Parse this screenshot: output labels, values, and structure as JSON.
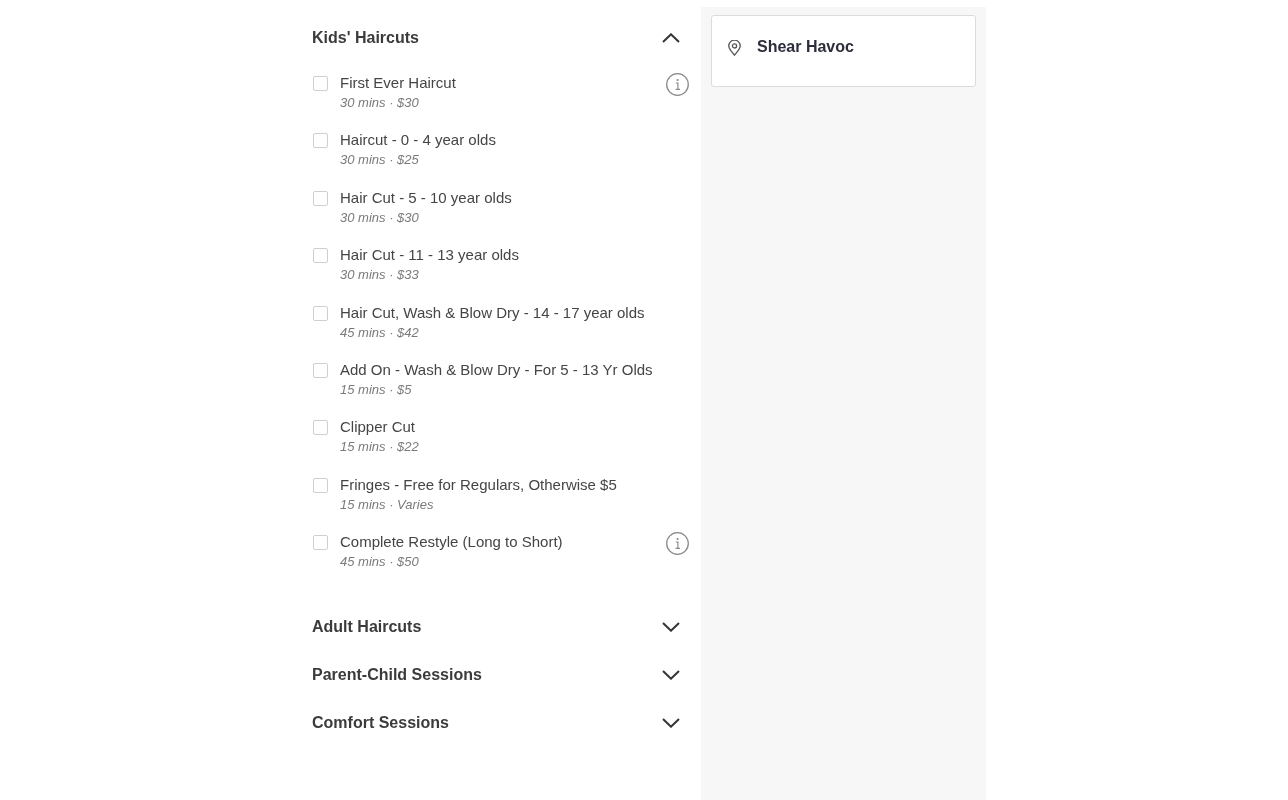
{
  "categories": [
    {
      "title": "Kids' Haircuts",
      "expanded": true,
      "services": [
        {
          "name": "First Ever Haircut",
          "details": "30 mins · $30",
          "checked": false,
          "info": true
        },
        {
          "name": "Haircut - 0 - 4 year olds",
          "details": "30 mins · $25",
          "checked": false,
          "info": false
        },
        {
          "name": "Hair Cut - 5 - 10 year olds",
          "details": "30 mins · $30",
          "checked": false,
          "info": false
        },
        {
          "name": "Hair Cut - 11 - 13 year olds",
          "details": "30 mins · $33",
          "checked": false,
          "info": false
        },
        {
          "name": "Hair Cut, Wash & Blow Dry - 14 - 17 year olds",
          "details": "45 mins · $42",
          "checked": false,
          "info": false
        },
        {
          "name": "Add On - Wash & Blow Dry - For 5 - 13 Yr Olds",
          "details": "15 mins · $5",
          "checked": false,
          "info": false
        },
        {
          "name": "Clipper Cut",
          "details": "15 mins · $22",
          "checked": false,
          "info": false
        },
        {
          "name": "Fringes - Free for Regulars, Otherwise $5",
          "details": "15 mins · Varies",
          "checked": false,
          "info": false
        },
        {
          "name": "Complete Restyle (Long to Short)",
          "details": "45 mins · $50",
          "checked": false,
          "info": true
        }
      ]
    },
    {
      "title": "Adult Haircuts",
      "expanded": false
    },
    {
      "title": "Parent-Child Sessions",
      "expanded": false
    },
    {
      "title": "Comfort Sessions",
      "expanded": false
    }
  ],
  "location": {
    "name": "Shear Havoc"
  }
}
